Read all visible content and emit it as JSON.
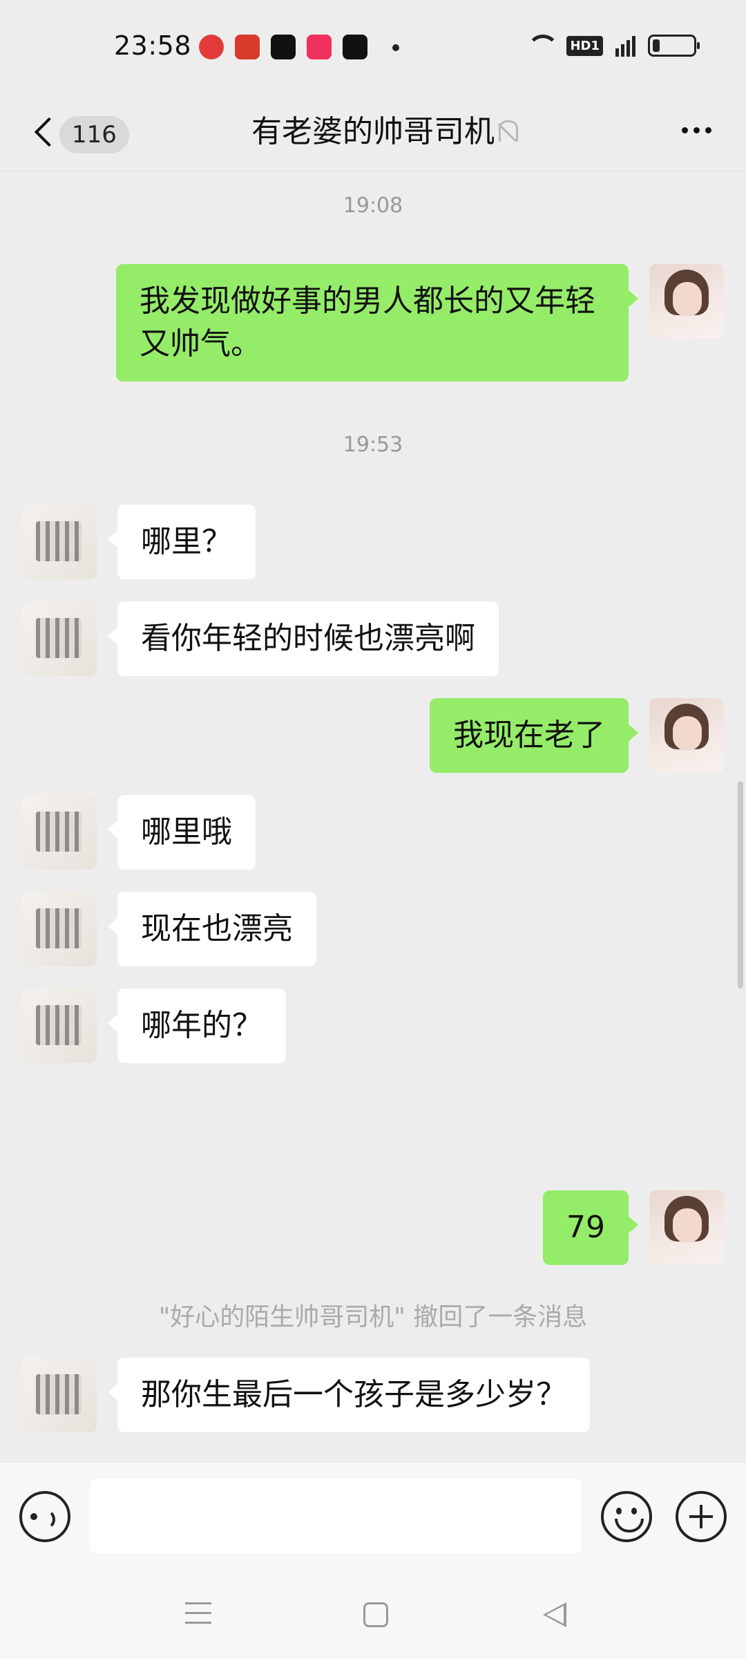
{
  "status_bar": {
    "time": "23:58",
    "notification_icons": [
      "app-icon",
      "toutiao-icon",
      "douyin-icon",
      "kuaishou-icon",
      "douyin-icon"
    ],
    "hd_label": "HD1",
    "network": "5G"
  },
  "header": {
    "unread_count": "116",
    "title": "有老婆的帅哥司机"
  },
  "messages": [
    {
      "type": "timestamp",
      "text": "19:08"
    },
    {
      "type": "sent",
      "text": "我发现做好事的男人都长的又年轻又帅气。"
    },
    {
      "type": "timestamp",
      "text": "19:53"
    },
    {
      "type": "received",
      "text": "哪里？"
    },
    {
      "type": "received",
      "text": "看你年轻的时候也漂亮啊"
    },
    {
      "type": "sent",
      "text": "我现在老了"
    },
    {
      "type": "received",
      "text": "哪里哦"
    },
    {
      "type": "received",
      "text": "现在也漂亮"
    },
    {
      "type": "received",
      "text": "哪年的？"
    },
    {
      "type": "sent",
      "text": "79"
    },
    {
      "type": "recall",
      "text": "\"好心的陌生帅哥司机\" 撤回了一条消息"
    },
    {
      "type": "received",
      "text": "那你生最后一个孩子是多少岁？"
    }
  ],
  "input": {
    "value": "",
    "placeholder": ""
  },
  "colors": {
    "sent_bubble": "#95ec69",
    "received_bubble": "#ffffff",
    "background": "#ededed"
  }
}
